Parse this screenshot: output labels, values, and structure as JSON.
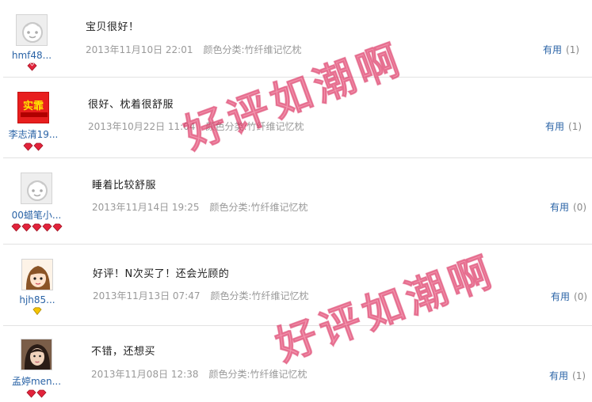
{
  "colors": {
    "link": "#2a63a6",
    "meta": "#999999",
    "watermark": "#e83c69",
    "divider": "#e2e2e2"
  },
  "watermark": "好评如潮啊",
  "useful_label": "有用",
  "sku_prefix": "颜色分类:",
  "reviews": [
    {
      "nick": "hmf48...",
      "avatar": "default-avatar-icon",
      "rank_icon": "red-diamond-icon",
      "rank_count": 1,
      "content": "宝贝很好！",
      "date": "2013年11月10日 22:01",
      "sku": "竹纤维记忆枕",
      "useful_count": "(1)"
    },
    {
      "nick": "李志清19...",
      "avatar": "shop-logo-avatar",
      "avatar_text": "实霏",
      "rank_icon": "red-diamond-icon",
      "rank_count": 2,
      "content": "很好、枕着很舒服",
      "date": "2013年10月22日 11:04",
      "sku": "竹纤维记忆枕",
      "useful_count": "(1)"
    },
    {
      "nick": "00蜡笔小...",
      "avatar": "default-avatar-icon",
      "rank_icon": "red-diamond-icon",
      "rank_count": 5,
      "content": "睡着比较舒服",
      "date": "2013年11月14日 19:25",
      "sku": "竹纤维记忆枕",
      "useful_count": "(0)"
    },
    {
      "nick": "hjh85...",
      "avatar": "cartoon-girl-avatar",
      "rank_icon": "yellow-heart-icon",
      "rank_count": 1,
      "content": "好评！N次买了！还会光顾的",
      "date": "2013年11月13日 07:47",
      "sku": "竹纤维记忆枕",
      "useful_count": "(0)"
    },
    {
      "nick": "孟婷men...",
      "avatar": "photo-avatar",
      "rank_icon": "red-diamond-icon",
      "rank_count": 2,
      "content": "不错，还想买",
      "date": "2013年11月08日 12:38",
      "sku": "竹纤维记忆枕",
      "useful_count": "(1)"
    }
  ]
}
